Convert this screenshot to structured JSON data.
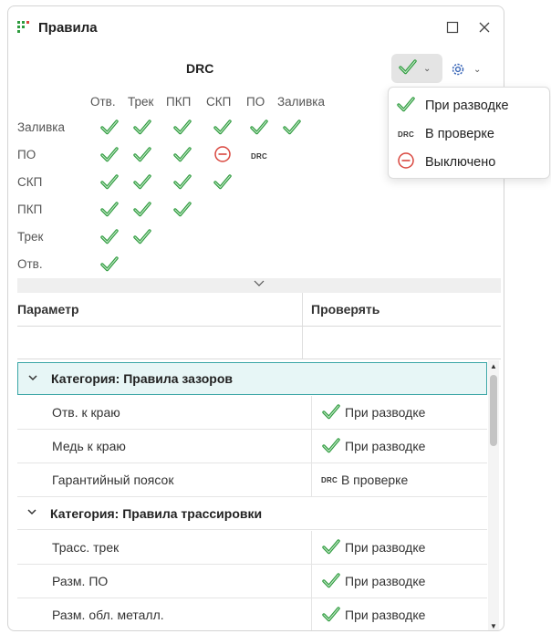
{
  "window": {
    "title": "Правила"
  },
  "drc": {
    "title": "DRC"
  },
  "matrix": {
    "columns": [
      "Отв.",
      "Трек",
      "ПКП",
      "СКП",
      "ПО",
      "Заливка"
    ],
    "rows": [
      {
        "label": "Заливка",
        "cells": [
          "check",
          "check",
          "check",
          "check",
          "check",
          "check"
        ]
      },
      {
        "label": "ПО",
        "cells": [
          "check",
          "check",
          "check",
          "off",
          "drc"
        ]
      },
      {
        "label": "СКП",
        "cells": [
          "check",
          "check",
          "check",
          "check"
        ]
      },
      {
        "label": "ПКП",
        "cells": [
          "check",
          "check",
          "check"
        ]
      },
      {
        "label": "Трек",
        "cells": [
          "check",
          "check"
        ]
      },
      {
        "label": "Отв.",
        "cells": [
          "check"
        ]
      }
    ],
    "drc_tag": "DRC"
  },
  "table": {
    "col_param": "Параметр",
    "col_check": "Проверять",
    "rows": [
      {
        "type": "category",
        "label": "Категория: Правила зазоров",
        "selected": true
      },
      {
        "type": "item",
        "name": "Отв. к краю",
        "status": "check",
        "value": "При разводке"
      },
      {
        "type": "item",
        "name": "Медь к краю",
        "status": "check",
        "value": "При разводке"
      },
      {
        "type": "item",
        "name": "Гарантийный поясок",
        "status": "drc",
        "value": "В проверке"
      },
      {
        "type": "category",
        "label": "Категория: Правила трассировки",
        "selected": false
      },
      {
        "type": "item",
        "name": "Трасс. трек",
        "status": "check",
        "value": "При разводке"
      },
      {
        "type": "item",
        "name": "Разм. ПО",
        "status": "check",
        "value": "При разводке"
      },
      {
        "type": "item",
        "name": "Разм. обл. металл.",
        "status": "check",
        "value": "При разводке"
      }
    ]
  },
  "dropdown": {
    "items": [
      {
        "icon": "check",
        "label": "При разводке"
      },
      {
        "icon": "drc",
        "label": "В проверке"
      },
      {
        "icon": "off",
        "label": "Выключено"
      }
    ]
  },
  "colors": {
    "check": "#2e9b3e",
    "off": "#d9463e",
    "accent": "#3aa6a6"
  }
}
